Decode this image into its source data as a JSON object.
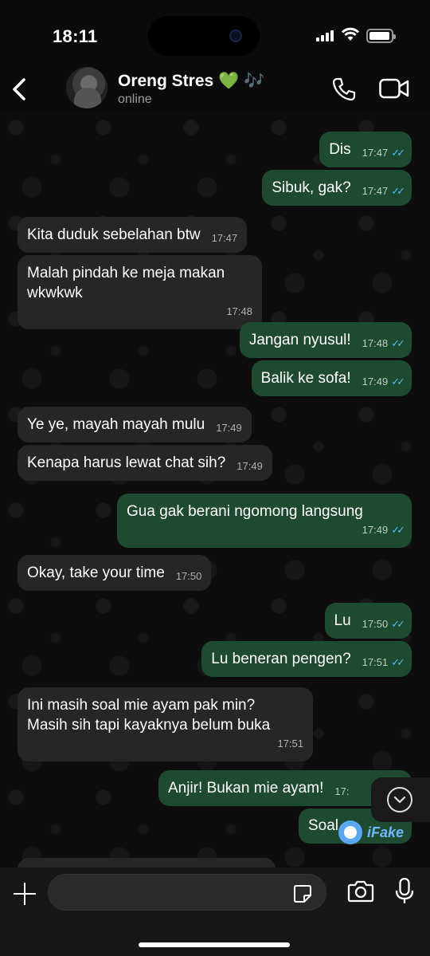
{
  "status_bar": {
    "time": "18:11"
  },
  "header": {
    "contact_name": "Oreng Stres",
    "name_heart": "💚",
    "name_notes": "🎶",
    "status": "online"
  },
  "messages": [
    {
      "dir": "out",
      "text": "Dis",
      "time": "17:47",
      "ticks": "✓✓"
    },
    {
      "dir": "out",
      "text": "Sibuk, gak?",
      "time": "17:47",
      "ticks": "✓✓"
    },
    {
      "dir": "in",
      "text": "Kita duduk sebelahan btw",
      "time": "17:47"
    },
    {
      "dir": "in",
      "text": "Malah pindah ke meja makan\nwkwkwk",
      "time": "17:48"
    },
    {
      "dir": "out",
      "text": "Jangan nyusul!",
      "time": "17:48",
      "ticks": "✓✓"
    },
    {
      "dir": "out",
      "text": "Balik ke sofa!",
      "time": "17:49",
      "ticks": "✓✓"
    },
    {
      "dir": "in",
      "text": "Ye ye, mayah mayah mulu",
      "time": "17:49"
    },
    {
      "dir": "in",
      "text": "Kenapa harus lewat chat sih?",
      "time": "17:49"
    },
    {
      "dir": "out",
      "text": "Gua gak berani ngomong langsung",
      "time": "17:49",
      "ticks": "✓✓"
    },
    {
      "dir": "in",
      "text": "Okay, take your time",
      "time": "17:50"
    },
    {
      "dir": "out",
      "text": "Lu",
      "time": "17:50",
      "ticks": "✓✓"
    },
    {
      "dir": "out",
      "text": "Lu beneran pengen?",
      "time": "17:51",
      "ticks": "✓✓"
    },
    {
      "dir": "in",
      "text": "Ini masih soal mie ayam pak min?\nMasih sih tapi kayaknya belum buka",
      "time": "17:51"
    },
    {
      "dir": "out",
      "text": "Anjir! Bukan mie ayam!",
      "time": "17:",
      "ticks": ""
    },
    {
      "dir": "out",
      "text": "Soal",
      "time": "",
      "ticks": ""
    }
  ],
  "watermark": {
    "label": "iFake"
  },
  "input": {
    "placeholder": ""
  },
  "colors": {
    "outgoing_bubble": "#1e4a32",
    "incoming_bubble": "#262626",
    "read_ticks": "#53bdeb",
    "accent_green": "#2ecc40"
  }
}
